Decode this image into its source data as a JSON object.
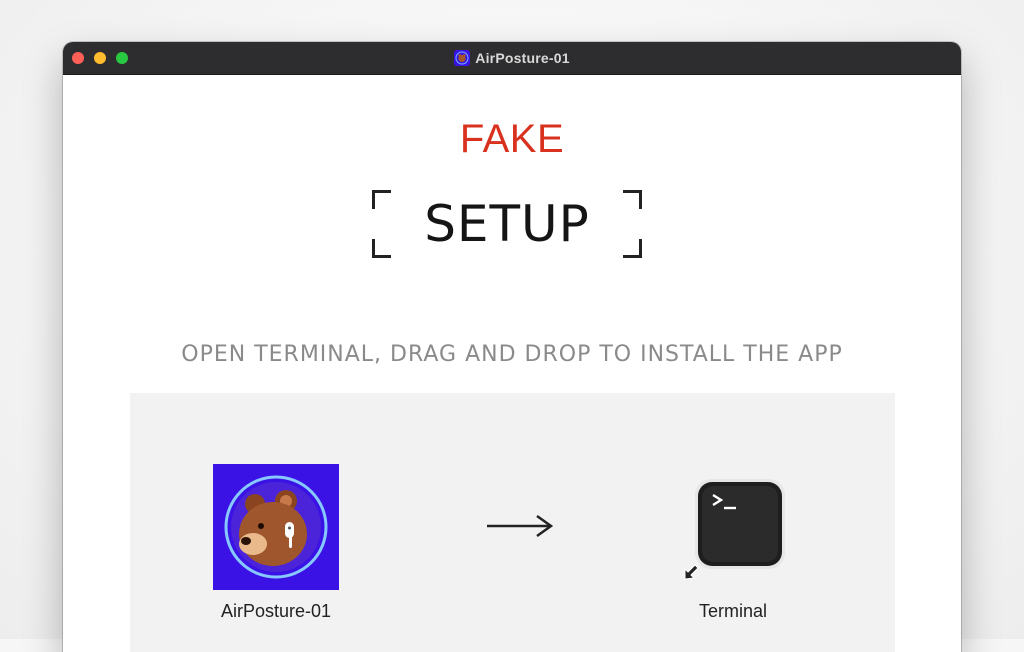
{
  "window": {
    "title": "AirPosture-01",
    "title_icon": "bear-app-icon"
  },
  "main": {
    "fake_label": "FAKE",
    "setup_label": "SETUP",
    "instruction": "OPEN TERMINAL, DRAG AND DROP TO INSTALL THE APP"
  },
  "dropzone": {
    "app_name": "AirPosture-01",
    "app_icon": "bear-app-icon",
    "arrow_icon": "right-arrow-icon",
    "target_name": "Terminal",
    "target_icon": "terminal-icon"
  },
  "colors": {
    "fake_red": "#d8321f",
    "app_tile_purple": "#3b12e6",
    "titlebar_dark": "#2d2d2f"
  }
}
